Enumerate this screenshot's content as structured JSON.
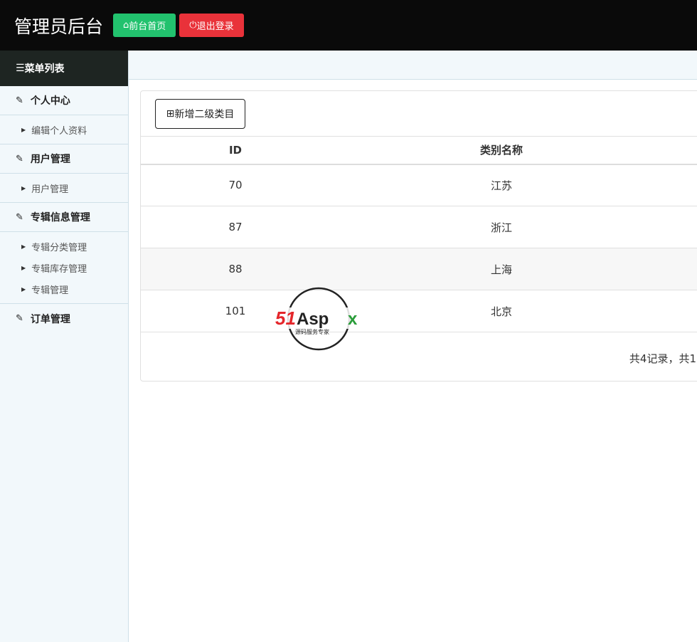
{
  "header": {
    "title": "管理员后台",
    "home_label": "前台首页",
    "logout_label": "退出登录"
  },
  "sidebar": {
    "menu_title": "菜单列表",
    "groups": [
      {
        "label": "个人中心",
        "items": [
          "编辑个人资料"
        ]
      },
      {
        "label": "用户管理",
        "items": [
          "用户管理"
        ]
      },
      {
        "label": "专辑信息管理",
        "items": [
          "专辑分类管理",
          "专辑库存管理",
          "专辑管理"
        ]
      },
      {
        "label": "订单管理",
        "items": []
      }
    ]
  },
  "main": {
    "add_label": "新增二级类目",
    "columns": [
      "ID",
      "类别名称"
    ],
    "rows": [
      {
        "id": "70",
        "name": "江苏"
      },
      {
        "id": "87",
        "name": "浙江"
      },
      {
        "id": "88",
        "name": "上海"
      },
      {
        "id": "101",
        "name": "北京"
      }
    ],
    "pager": "共4记录，共1"
  },
  "watermark": {
    "brand": "51Aspx",
    "slogan": "源码服务专家"
  }
}
